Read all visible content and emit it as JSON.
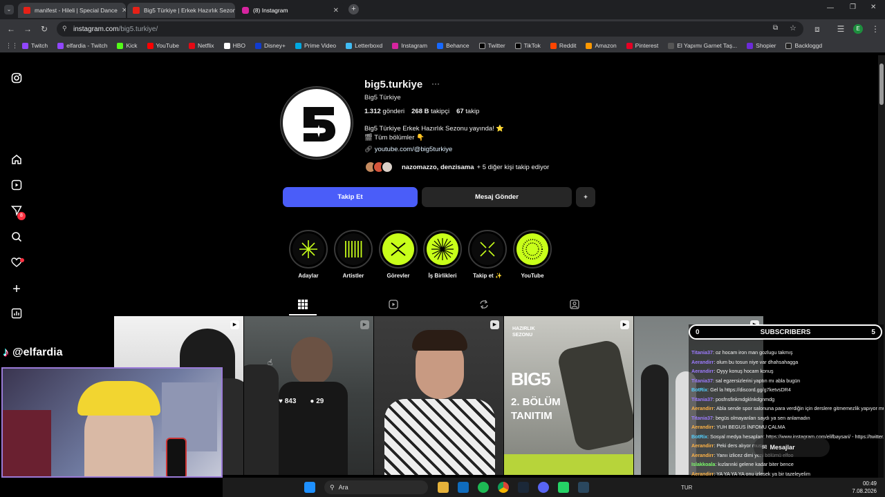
{
  "browser": {
    "tabs": [
      {
        "title": "manifest - Hileli | Special Dance",
        "color": "#e62117"
      },
      {
        "title": "Big5 Türkiye | Erkek Hazırlık Sezonu",
        "color": "#e62117"
      },
      {
        "title": "(8) Instagram",
        "color": "#d6249f"
      }
    ],
    "url_host": "instagram.com",
    "url_path": "/big5.turkiye/",
    "bookmarks": [
      {
        "label": "Twitch",
        "color": "#9146ff"
      },
      {
        "label": "elfardia - Twitch",
        "color": "#9146ff"
      },
      {
        "label": "Kick",
        "color": "#53fc18"
      },
      {
        "label": "YouTube",
        "color": "#ff0000"
      },
      {
        "label": "Netflix",
        "color": "#e50914"
      },
      {
        "label": "HBO",
        "color": "#ffffff"
      },
      {
        "label": "Disney+",
        "color": "#113ccf"
      },
      {
        "label": "Prime Video",
        "color": "#00a8e1"
      },
      {
        "label": "Letterboxd",
        "color": "#40bcf4"
      },
      {
        "label": "Instagram",
        "color": "#d6249f"
      },
      {
        "label": "Behance",
        "color": "#1769ff"
      },
      {
        "label": "Twitter",
        "color": "#000000"
      },
      {
        "label": "TikTok",
        "color": "#000000"
      },
      {
        "label": "Reddit",
        "color": "#ff4500"
      },
      {
        "label": "Amazon",
        "color": "#ff9900"
      },
      {
        "label": "Pinterest",
        "color": "#e60023"
      },
      {
        "label": "El Yapımı Garnet Taş...",
        "color": "#555555"
      },
      {
        "label": "Shopier",
        "color": "#6c2bd9"
      },
      {
        "label": "Backloggd",
        "color": "#222222"
      }
    ],
    "profile_initial": "E"
  },
  "profile": {
    "username": "big5.turkiye",
    "more": "···",
    "full_name": "Big5 Türkiye",
    "posts_count": "1.312",
    "posts_label": "gönderi",
    "followers_count": "268 B",
    "followers_label": "takipçi",
    "following_count": "67",
    "following_label": "takip",
    "bio_line1": "Big5 Türkiye Erkek Hazırlık Sezonu yayında! ⭐",
    "bio_line2": "🎬 Tüm bölümler 👇",
    "link": "youtube.com/@big5turkiye",
    "followed_by_names": "nazomazzo, denzisama",
    "followed_by_rest": "+ 5 diğer kişi takip ediyor",
    "follow_btn": "Takip Et",
    "message_btn": "Mesaj Gönder",
    "add_user_btn": "+"
  },
  "highlights": [
    {
      "label": "Adaylar",
      "style": "dark"
    },
    {
      "label": "Artistler",
      "style": "dark"
    },
    {
      "label": "Görevler",
      "style": "lime"
    },
    {
      "label": "İş Birlikleri",
      "style": "lime"
    },
    {
      "label": "Takip et ✨",
      "style": "dark"
    },
    {
      "label": "YouTube",
      "style": "lime"
    }
  ],
  "post_overlay": {
    "likes": "843",
    "comments": "29"
  },
  "tile3": {
    "top_text": "HAZIRLIK SEZONU",
    "brand": "BIG5",
    "line1": "2. BÖLÜM",
    "line2": "TANITIM"
  },
  "sidebar_badge": "8",
  "stream": {
    "handle": "@elfardia",
    "subs_left": "0",
    "subs_title": "SUBSCRIBERS",
    "subs_right": "5",
    "chat": [
      {
        "user": "Titania37",
        "msg": ": oz hocam iron man gozlugu takmış",
        "color": "#9d7bff"
      },
      {
        "user": "Aerandirr",
        "msg": ": olum bu tosun niye var dhahsahagga",
        "color": "#9d7bff"
      },
      {
        "user": "Aerandirr",
        "msg": ": Oyyy konuş hocam konuş",
        "color": "#9d7bff"
      },
      {
        "user": "Titania37",
        "msg": ": sal egzersizlerini yaptın mı abla bugün",
        "color": "#9d7bff"
      },
      {
        "user": "BotRix",
        "msg": ": Gel la https://discord.gg/g7ketvsDR4",
        "color": "#54d1ff"
      },
      {
        "user": "Titania37",
        "msg": ": posfnsfinkmdgklnkdgnmdg",
        "color": "#9d7bff"
      },
      {
        "user": "Aerandirr",
        "msg": ": Abla sende spor salonuna para verdiğin için derslere gitmemezlik yapıyor musun",
        "color": "#ffb347"
      },
      {
        "user": "Titania37",
        "msg": ": begüs olmayanları saydı ya sen anlamadın",
        "color": "#9d7bff"
      },
      {
        "user": "Aerandirr",
        "msg": ": YUH BEGUS İNFOMU ÇALMA",
        "color": "#ffb347"
      },
      {
        "user": "BotRix",
        "msg": ": Sosyal medya hesapları: https://www.instagram.com/elifbaysari/ - https://twitter.com/elfardia",
        "color": "#54d1ff"
      },
      {
        "user": "Aerandirr",
        "msg": ": Peki ders alıyor musun",
        "color": "#ffb347"
      },
      {
        "user": "Aerandirr",
        "msg": ": Yanıı izlicez dimi yeni bölümü elfoo",
        "color": "#ffb347"
      },
      {
        "user": "Islakkoala",
        "msg": ": kızlarınki gelene kadar biter bence",
        "color": "#7cff6b"
      },
      {
        "user": "Aerandirr",
        "msg": ": YA YA YA YA onu izlesek ya bir tazeleyelim",
        "color": "#ffb347"
      }
    ],
    "messages_label": "Mesajlar"
  },
  "taskbar": {
    "search": "Ara",
    "lang": "TUR",
    "time": "00:49",
    "date": "7.08.2026"
  }
}
